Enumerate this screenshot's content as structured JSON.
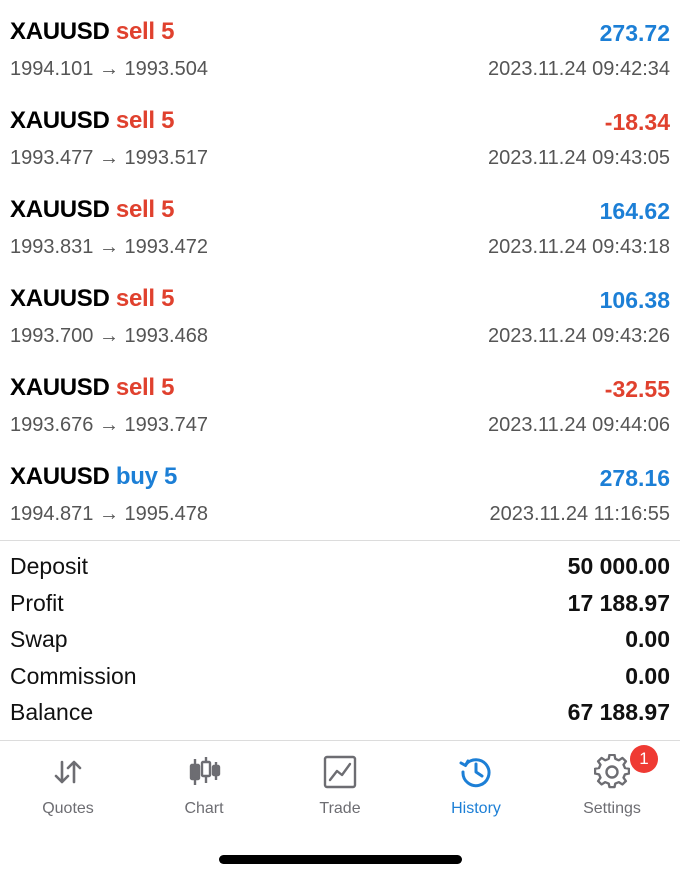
{
  "trades": [
    {
      "symbol": "XAUUSD",
      "direction": "sell 5",
      "direction_color": "#e0412e",
      "profit": "273.72",
      "profit_color": "#1c7fd6",
      "prices": "1994.101 → 1993.504",
      "time": "2023.11.24 09:42:34"
    },
    {
      "symbol": "XAUUSD",
      "direction": "sell 5",
      "direction_color": "#e0412e",
      "profit": "-18.34",
      "profit_color": "#e0412e",
      "prices": "1993.477 → 1993.517",
      "time": "2023.11.24 09:43:05"
    },
    {
      "symbol": "XAUUSD",
      "direction": "sell 5",
      "direction_color": "#e0412e",
      "profit": "164.62",
      "profit_color": "#1c7fd6",
      "prices": "1993.831 → 1993.472",
      "time": "2023.11.24 09:43:18"
    },
    {
      "symbol": "XAUUSD",
      "direction": "sell 5",
      "direction_color": "#e0412e",
      "profit": "106.38",
      "profit_color": "#1c7fd6",
      "prices": "1993.700 → 1993.468",
      "time": "2023.11.24 09:43:26"
    },
    {
      "symbol": "XAUUSD",
      "direction": "sell 5",
      "direction_color": "#e0412e",
      "profit": "-32.55",
      "profit_color": "#e0412e",
      "prices": "1993.676 → 1993.747",
      "time": "2023.11.24 09:44:06"
    },
    {
      "symbol": "XAUUSD",
      "direction": "buy 5",
      "direction_color": "#1c7fd6",
      "profit": "278.16",
      "profit_color": "#1c7fd6",
      "prices": "1994.871 → 1995.478",
      "time": "2023.11.24 11:16:55"
    }
  ],
  "summary": [
    {
      "label": "Deposit",
      "value": "50 000.00"
    },
    {
      "label": "Profit",
      "value": "17 188.97"
    },
    {
      "label": "Swap",
      "value": "0.00"
    },
    {
      "label": "Commission",
      "value": "0.00"
    },
    {
      "label": "Balance",
      "value": "67 188.97"
    }
  ],
  "tabs": [
    {
      "label": "Quotes",
      "icon": "quotes-icon",
      "active": false
    },
    {
      "label": "Chart",
      "icon": "chart-icon",
      "active": false
    },
    {
      "label": "Trade",
      "icon": "trade-icon",
      "active": false
    },
    {
      "label": "History",
      "icon": "history-icon",
      "active": true
    },
    {
      "label": "Settings",
      "icon": "gear-icon",
      "active": false,
      "badge": "1"
    }
  ],
  "colors": {
    "accent": "#1c7fd6",
    "loss": "#e0412e",
    "badge": "#ef3a33"
  }
}
